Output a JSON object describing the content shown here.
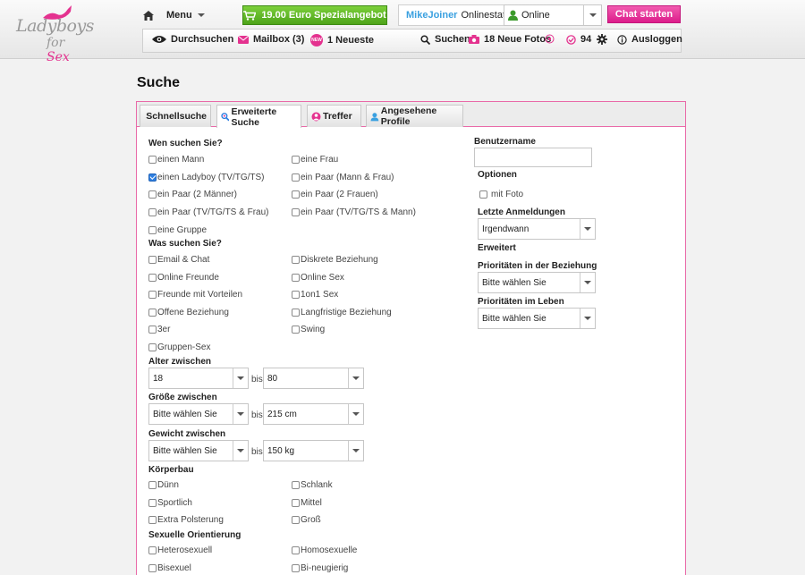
{
  "logo": {
    "line1": "Ladyboys",
    "line2a": "for ",
    "line2b": "Sex"
  },
  "header": {
    "menu_label": "Menu",
    "promo_label": "19.00 Euro Spezialangebot",
    "username": "MikeJoiner",
    "status_label": "Onlinestatus",
    "status_value": "Online",
    "chat_label": "Chat starten"
  },
  "nav": {
    "search_browse": "Durchsuchen",
    "mailbox": "Mailbox (3)",
    "new_badge": "NEW",
    "newest": "1 Neueste",
    "search": "Suchen",
    "photos": "18 Neue Fotos",
    "points": "94",
    "logout": "Ausloggen"
  },
  "page_title": "Suche",
  "tabs": [
    "Schnellsuche",
    "Erweiterte Suche",
    "Treffer",
    "Angesehene Profile"
  ],
  "colors": {
    "accent_pink": "#e4328f",
    "promo_green": "#5cb425",
    "link_blue": "#3aa0e0"
  },
  "form": {
    "who_title": "Wen suchen Sie?",
    "who": [
      {
        "label": "einen Mann",
        "checked": false
      },
      {
        "label": "eine Frau",
        "checked": false
      },
      {
        "label": "einen Ladyboy (TV/TG/TS)",
        "checked": true
      },
      {
        "label": "ein Paar (Mann & Frau)",
        "checked": false
      },
      {
        "label": "ein Paar (2 Männer)",
        "checked": false
      },
      {
        "label": "ein Paar (2 Frauen)",
        "checked": false
      },
      {
        "label": "ein Paar (TV/TG/TS & Frau)",
        "checked": false
      },
      {
        "label": "ein Paar (TV/TG/TS & Mann)",
        "checked": false
      },
      {
        "label": "eine Gruppe",
        "checked": false
      }
    ],
    "what_title": "Was suchen Sie?",
    "what": [
      {
        "label": "Email & Chat",
        "checked": false
      },
      {
        "label": "Diskrete Beziehung",
        "checked": false
      },
      {
        "label": "Online Freunde",
        "checked": false
      },
      {
        "label": "Online Sex",
        "checked": false
      },
      {
        "label": "Freunde mit Vorteilen",
        "checked": false
      },
      {
        "label": "1on1 Sex",
        "checked": false
      },
      {
        "label": "Offene Beziehung",
        "checked": false
      },
      {
        "label": "Langfristige Beziehung",
        "checked": false
      },
      {
        "label": "3er",
        "checked": false
      },
      {
        "label": "Swing",
        "checked": false
      },
      {
        "label": "Gruppen-Sex",
        "checked": false
      }
    ],
    "age_title": "Alter zwischen",
    "age_from": "18",
    "age_to": "80",
    "height_title": "Größe zwischen",
    "height_from": "Bitte wählen Sie",
    "height_to": "215 cm",
    "weight_title": "Gewicht zwischen",
    "weight_from": "Bitte wählen Sie",
    "weight_to": "150 kg",
    "between": "bis",
    "body_title": "Körperbau",
    "body": [
      {
        "label": "Dünn",
        "checked": false
      },
      {
        "label": "Schlank",
        "checked": false
      },
      {
        "label": "Sportlich",
        "checked": false
      },
      {
        "label": "Mittel",
        "checked": false
      },
      {
        "label": "Extra Polsterung",
        "checked": false
      },
      {
        "label": "Groß",
        "checked": false
      }
    ],
    "orientation_title": "Sexuelle Orientierung",
    "orientation": [
      {
        "label": "Heterosexuell",
        "checked": false
      },
      {
        "label": "Homosexuelle",
        "checked": false
      },
      {
        "label": "Bisexuel",
        "checked": false
      },
      {
        "label": "Bi-neugierig",
        "checked": false
      }
    ],
    "username_title": "Benutzername",
    "options_title": "Optionen",
    "with_photo": "mit Foto",
    "last_login_title": "Letzte Anmeldungen",
    "last_login_value": "Irgendwann",
    "extended_title": "Erweitert",
    "prio_rel_title": "Prioritäten in der Beziehung",
    "prio_rel_value": "Bitte wählen Sie",
    "prio_life_title": "Prioritäten im Leben",
    "prio_life_value": "Bitte wählen Sie"
  }
}
